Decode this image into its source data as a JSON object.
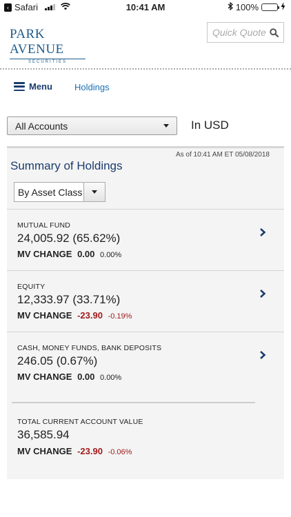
{
  "status_bar": {
    "carrier": "Safari",
    "time": "10:41 AM",
    "battery": "100%"
  },
  "header": {
    "logo_name": "PARK AVENUE",
    "logo_sub": "SECURITIES",
    "quick_quote_placeholder": "Quick Quote"
  },
  "nav": {
    "menu_label": "Menu",
    "holdings_label": "Holdings"
  },
  "account_select": {
    "value": "All Accounts",
    "currency": "In USD"
  },
  "summary": {
    "as_of": "As of  10:41 AM ET 05/08/2018",
    "title": "Summary of Holdings",
    "group_by": "By Asset Class",
    "rows": [
      {
        "category": "MUTUAL FUND",
        "amount": "24,005.92 (65.62%)",
        "mv_label": "MV CHANGE",
        "mv_value": "0.00",
        "mv_pct": "0.00%"
      },
      {
        "category": "EQUITY",
        "amount": "12,333.97 (33.71%)",
        "mv_label": "MV CHANGE",
        "mv_value": "-23.90",
        "mv_pct": "-0.19%"
      },
      {
        "category": "CASH, MONEY FUNDS, BANK DEPOSITS",
        "amount": "246.05 (0.67%)",
        "mv_label": "MV CHANGE",
        "mv_value": "0.00",
        "mv_pct": "0.00%"
      }
    ],
    "total": {
      "category": "TOTAL CURRENT ACCOUNT VALUE",
      "amount": "36,585.94",
      "mv_label": "MV CHANGE",
      "mv_value": "-23.90",
      "mv_pct": "-0.06%"
    }
  },
  "colors": {
    "brand": "#1a3c6e",
    "link": "#1a6fb3",
    "negative": "#a01c1c",
    "battery": "#4cd964"
  }
}
